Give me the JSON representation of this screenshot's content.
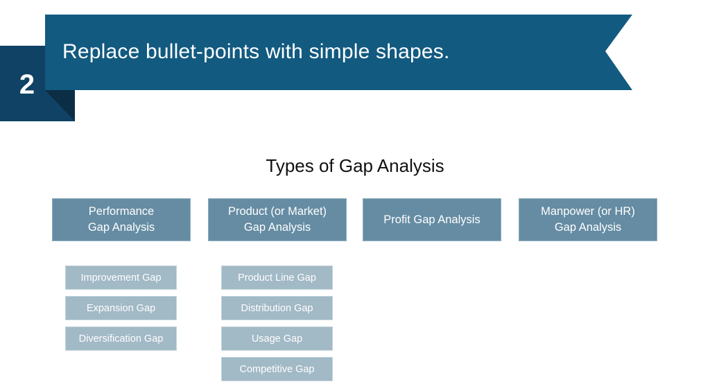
{
  "header": {
    "step_number": "2",
    "banner_text": "Replace bullet-points with simple shapes.",
    "colors": {
      "banner": "#125a80",
      "number_box": "#0f4264",
      "fold": "#0c2e44"
    }
  },
  "diagram": {
    "title": "Types of Gap Analysis",
    "categories": [
      {
        "label_line1": "Performance",
        "label_line2": "Gap Analysis",
        "subitems": [
          "Improvement Gap",
          "Expansion Gap",
          "Diversification Gap"
        ]
      },
      {
        "label_line1": "Product (or Market)",
        "label_line2": "Gap Analysis",
        "subitems": [
          "Product Line Gap",
          "Distribution Gap",
          "Usage Gap",
          "Competitive Gap"
        ]
      },
      {
        "label_line1": "Profit Gap Analysis",
        "label_line2": "",
        "subitems": []
      },
      {
        "label_line1": "Manpower (or HR)",
        "label_line2": "Gap Analysis",
        "subitems": []
      }
    ],
    "colors": {
      "category_box": "#658ca3",
      "subitem_box": "#a2b9c6"
    }
  }
}
